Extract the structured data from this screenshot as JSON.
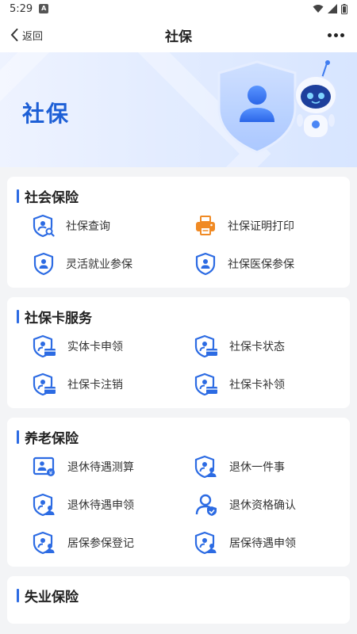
{
  "status": {
    "time": "5:29",
    "badge": "A"
  },
  "header": {
    "back_label": "返回",
    "title": "社保"
  },
  "banner": {
    "title": "社保"
  },
  "sections": [
    {
      "title": "社会保险",
      "items": [
        {
          "label": "社保查询",
          "icon": "shield-search-icon"
        },
        {
          "label": "社保证明打印",
          "icon": "printer-icon"
        },
        {
          "label": "灵活就业参保",
          "icon": "shield-user-icon"
        },
        {
          "label": "社保医保参保",
          "icon": "shield-user-icon"
        }
      ]
    },
    {
      "title": "社保卡服务",
      "items": [
        {
          "label": "实体卡申领",
          "icon": "shield-card-icon"
        },
        {
          "label": "社保卡状态",
          "icon": "shield-card-icon"
        },
        {
          "label": "社保卡注销",
          "icon": "shield-card-icon"
        },
        {
          "label": "社保卡补领",
          "icon": "shield-card-icon"
        }
      ]
    },
    {
      "title": "养老保险",
      "items": [
        {
          "label": "退休待遇测算",
          "icon": "calculator-icon"
        },
        {
          "label": "退休一件事",
          "icon": "shield-person-icon"
        },
        {
          "label": "退休待遇申领",
          "icon": "shield-person-icon"
        },
        {
          "label": "退休资格确认",
          "icon": "user-check-icon"
        },
        {
          "label": "居保参保登记",
          "icon": "shield-person-icon"
        },
        {
          "label": "居保待遇申领",
          "icon": "shield-person-icon"
        }
      ]
    },
    {
      "title": "失业保险",
      "items": []
    }
  ],
  "colors": {
    "primary": "#2c6be3",
    "accent_orange": "#f08a24",
    "background": "#f3f4f6"
  }
}
